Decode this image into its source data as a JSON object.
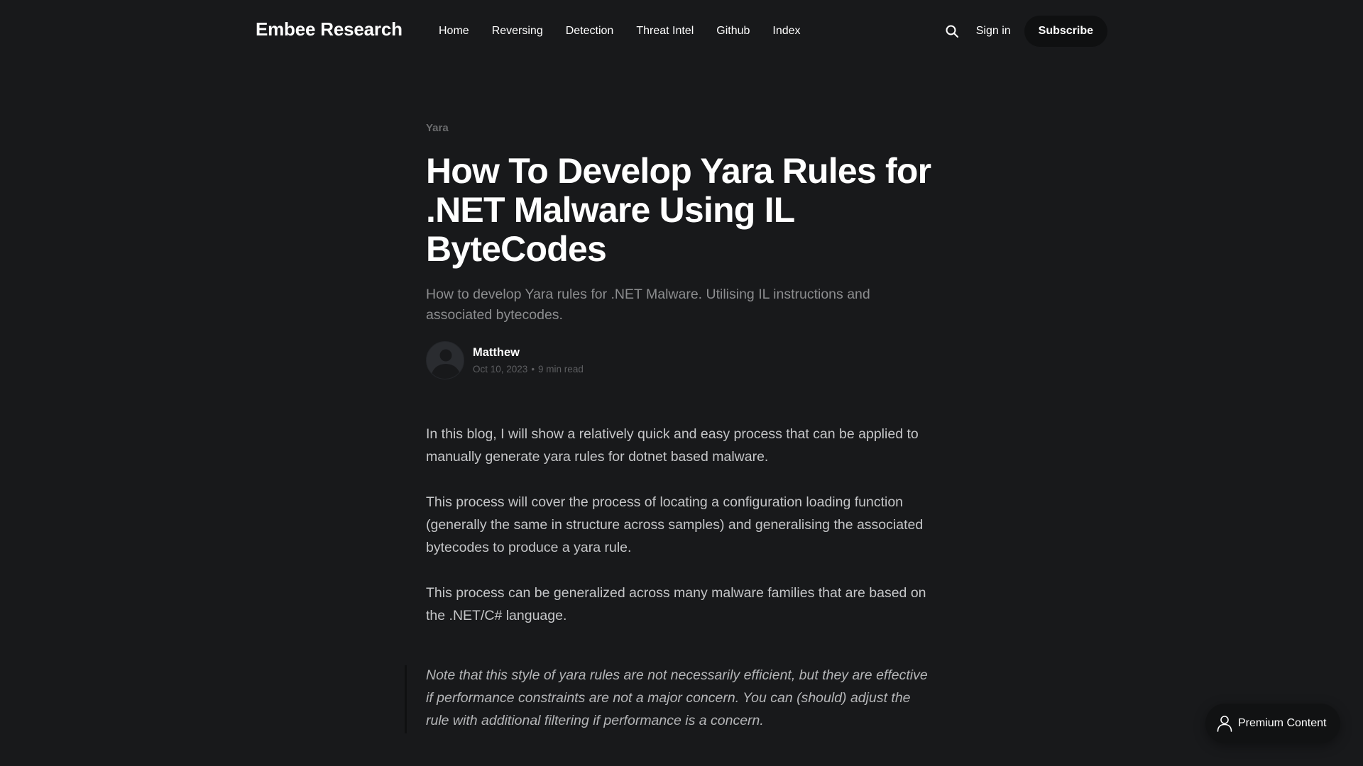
{
  "header": {
    "logo": "Embee Research",
    "nav": [
      "Home",
      "Reversing",
      "Detection",
      "Threat Intel",
      "Github",
      "Index"
    ],
    "search_icon": "search-icon",
    "sign_in": "Sign in",
    "subscribe": "Subscribe"
  },
  "article": {
    "tag": "Yara",
    "title": "How To Develop Yara Rules for .NET Malware Using IL ByteCodes",
    "excerpt": "How to develop Yara rules for .NET Malware. Utilising IL instructions and associated bytecodes.",
    "author": {
      "name": "Matthew",
      "avatar_icon": "user-avatar-icon",
      "date": "Oct 10, 2023",
      "separator": "•",
      "read_time": "9 min read"
    }
  },
  "content": {
    "paragraphs": [
      "In this blog, I will show a relatively quick and easy process that can be applied to manually generate yara rules for dotnet based malware.",
      "This process will cover the process of locating a configuration loading function (generally the same in structure across samples) and generalising the associated bytecodes to produce a yara rule.",
      "This process can be generalized across many malware families that are based on the .NET/C# language."
    ],
    "blockquote": "Note that this style of yara rules are not necessarily efficient, but they are effective if performance constraints are not a major concern. You can (should) adjust the rule with additional filtering if performance is a concern."
  },
  "premium_button": {
    "icon": "user-icon",
    "label": "Premium Content"
  }
}
